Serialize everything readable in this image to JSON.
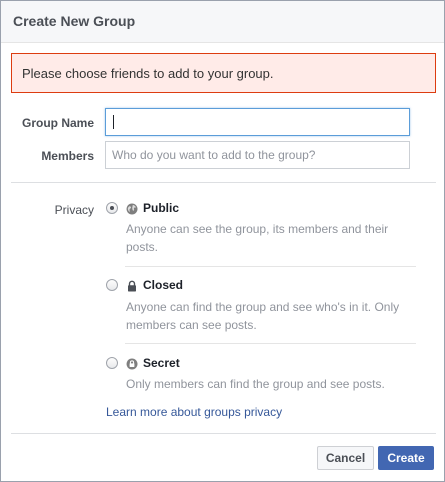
{
  "dialog": {
    "title": "Create New Group"
  },
  "error": {
    "message": "Please choose friends to add to your group."
  },
  "form": {
    "group_name": {
      "label": "Group Name",
      "value": "",
      "placeholder": ""
    },
    "members": {
      "label": "Members",
      "value": "",
      "placeholder": "Who do you want to add to the group?"
    },
    "privacy": {
      "label": "Privacy",
      "selected": "public",
      "options": [
        {
          "id": "public",
          "title": "Public",
          "icon": "globe-icon",
          "description": "Anyone can see the group, its members and their posts.",
          "checked": true
        },
        {
          "id": "closed",
          "title": "Closed",
          "icon": "lock-icon",
          "description": "Anyone can find the group and see who's in it. Only members can see posts.",
          "checked": false
        },
        {
          "id": "secret",
          "title": "Secret",
          "icon": "secret-lock-icon",
          "description": "Only members can find the group and see posts.",
          "checked": false
        }
      ]
    },
    "learn_more": "Learn more about groups privacy"
  },
  "footer": {
    "cancel_label": "Cancel",
    "create_label": "Create"
  },
  "colors": {
    "header_bg": "#f6f7f9",
    "error_bg": "#ffebe8",
    "error_border": "#dd3c10",
    "link": "#365899",
    "primary_button": "#4267b2",
    "focus_border": "#5b9dd9"
  }
}
